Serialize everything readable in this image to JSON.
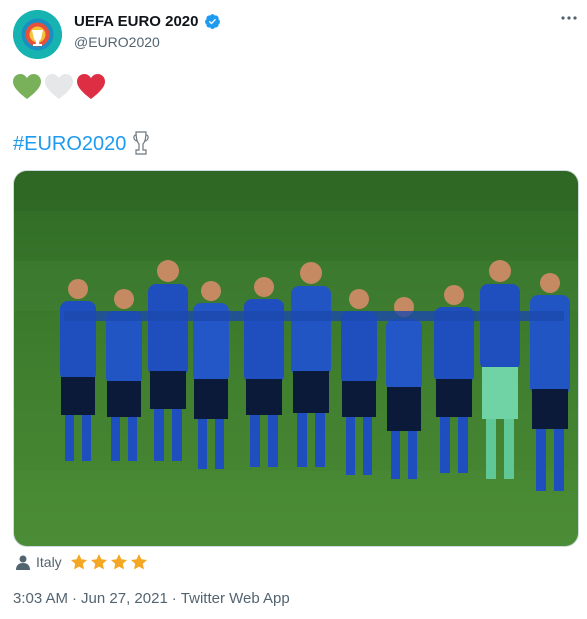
{
  "author": {
    "display_name": "UEFA EURO 2020",
    "handle": "@EURO2020",
    "verified": true,
    "avatar_icon": "euro2020-logo-icon"
  },
  "body": {
    "hearts": [
      {
        "icon": "green-heart-icon",
        "color": "#78b159"
      },
      {
        "icon": "white-heart-icon",
        "color": "#e6e7e8"
      },
      {
        "icon": "red-heart-icon",
        "color": "#dd2e44"
      }
    ],
    "hashtag": "#EURO2020",
    "hashtag_icon": "trophy-icon"
  },
  "tagged": {
    "icon": "person-icon",
    "name": "Italy",
    "rating_stars": 4
  },
  "meta": {
    "time": "3:03 AM",
    "separator": "·",
    "date": "Jun 27, 2021",
    "source": "Twitter Web App"
  },
  "colors": {
    "link": "#1d9bf0",
    "secondary_text": "#536471",
    "verified": "#1d9bf0",
    "star": "#f5a623",
    "pitch": "#3f7a2b",
    "kit_blue": "#1f4fbf"
  }
}
